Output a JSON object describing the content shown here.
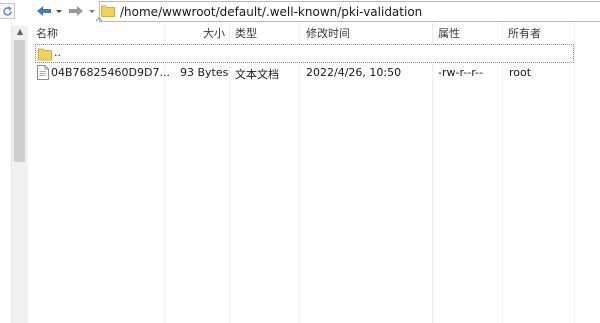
{
  "toolbar": {
    "path": "/home/wwwroot/default/.well-known/pki-validation"
  },
  "columns": {
    "name": "名称",
    "size": "大小",
    "type": "类型",
    "modified": "修改时间",
    "attributes": "属性",
    "owner": "所有者"
  },
  "rows": [
    {
      "name": "..",
      "size": "",
      "type": "",
      "modified": "",
      "attributes": "",
      "owner": ""
    },
    {
      "name": "04B76825460D9D7...",
      "size": "93 Bytes",
      "type": "文本文档",
      "modified": "2022/4/26, 10:50",
      "attributes": "-rw-r--r--",
      "owner": "root"
    }
  ],
  "colors": {
    "folder": "#f4cf5d",
    "folder_dark": "#e0b23c",
    "nav_arrow": "#3d7cc9",
    "grid": "#f0f0f0"
  }
}
